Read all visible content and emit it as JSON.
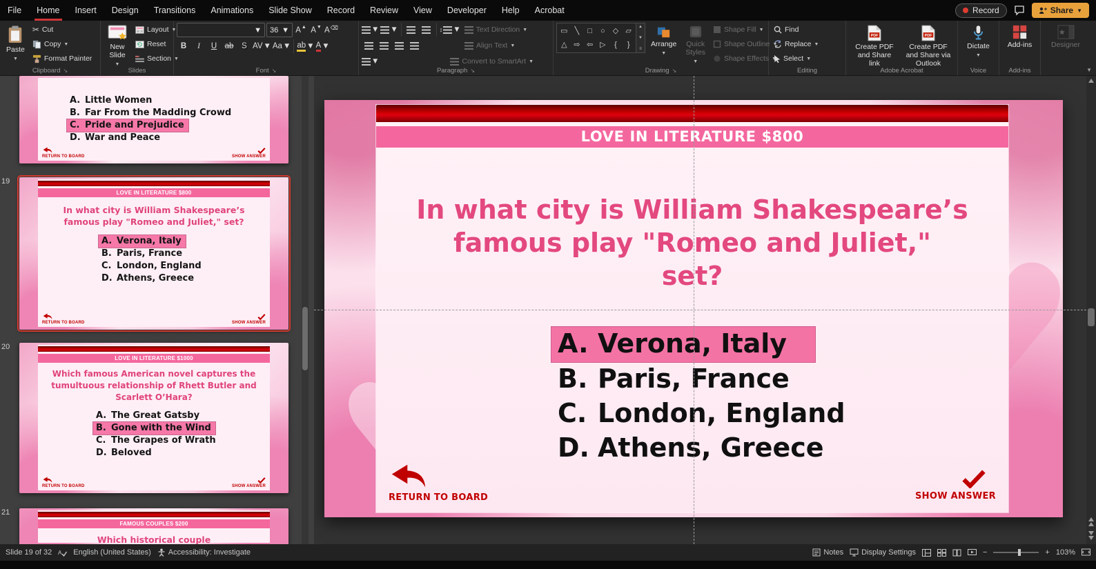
{
  "titlebar": {
    "menus": [
      "File",
      "Home",
      "Insert",
      "Design",
      "Transitions",
      "Animations",
      "Slide Show",
      "Record",
      "Review",
      "View",
      "Developer",
      "Help",
      "Acrobat"
    ],
    "record_button": "Record",
    "share_button": "Share"
  },
  "ribbon": {
    "clipboard": {
      "group": "Clipboard",
      "paste": "Paste",
      "cut": "Cut",
      "copy": "Copy",
      "format_painter": "Format Painter"
    },
    "slides": {
      "group": "Slides",
      "new_slide": "New Slide",
      "layout": "Layout",
      "reset": "Reset",
      "section": "Section"
    },
    "font": {
      "group": "Font",
      "font_name": "",
      "font_size": "36"
    },
    "paragraph": {
      "group": "Paragraph",
      "text_direction": "Text Direction",
      "align_text": "Align Text",
      "smartart": "Convert to SmartArt"
    },
    "drawing": {
      "group": "Drawing",
      "arrange": "Arrange",
      "quick_styles": "Quick Styles",
      "shape_fill": "Shape Fill",
      "shape_outline": "Shape Outline",
      "shape_effects": "Shape Effects"
    },
    "editing": {
      "group": "Editing",
      "find": "Find",
      "replace": "Replace",
      "select": "Select"
    },
    "acrobat": {
      "group": "Adobe Acrobat",
      "create_share": "Create PDF and Share link",
      "create_outlook": "Create PDF and Share via Outlook"
    },
    "voice": {
      "group": "Voice",
      "dictate": "Dictate"
    },
    "addins": {
      "group": "Add-ins",
      "addins": "Add-ins"
    },
    "designer": {
      "designer": "Designer"
    }
  },
  "thumbnails": {
    "prev_partial": {
      "options": [
        {
          "letter": "A.",
          "text": "Little Women"
        },
        {
          "letter": "B.",
          "text": "Far From the Madding Crowd"
        },
        {
          "letter": "C.",
          "text": "Pride and Prejudice"
        },
        {
          "letter": "D.",
          "text": "War and Peace"
        }
      ],
      "return_label": "RETURN TO BOARD",
      "show_label": "SHOW ANSWER"
    },
    "slide19": {
      "number": "19",
      "header": "LOVE IN LITERATURE $800",
      "question": "In what city is William Shakespeare’s famous play \"Romeo and Juliet,\" set?",
      "options": [
        {
          "letter": "A.",
          "text": "Verona, Italy"
        },
        {
          "letter": "B.",
          "text": "Paris, France"
        },
        {
          "letter": "C.",
          "text": "London, England"
        },
        {
          "letter": "D.",
          "text": "Athens, Greece"
        }
      ],
      "return_label": "RETURN TO BOARD",
      "show_label": "SHOW ANSWER"
    },
    "slide20": {
      "number": "20",
      "header": "LOVE IN LITERATURE $1000",
      "question": "Which famous American novel captures the tumultuous relationship of Rhett Butler and Scarlett O’Hara?",
      "options": [
        {
          "letter": "A.",
          "text": "The Great Gatsby"
        },
        {
          "letter": "B.",
          "text": "Gone with the Wind"
        },
        {
          "letter": "C.",
          "text": "The Grapes of Wrath"
        },
        {
          "letter": "D.",
          "text": "Beloved"
        }
      ],
      "return_label": "RETURN TO BOARD",
      "show_label": "SHOW ANSWER"
    },
    "slide21": {
      "number": "21",
      "header": "FAMOUS COUPLES $200",
      "question_partial": "Which historical couple"
    }
  },
  "slide": {
    "header": "LOVE IN LITERATURE $800",
    "question_line1": "In what city is William Shakespeare’s",
    "question_line2": "famous play \"Romeo and Juliet,\"",
    "question_line3": "set?",
    "options": [
      {
        "letter": "A.",
        "text": "Verona, Italy"
      },
      {
        "letter": "B.",
        "text": "Paris, France"
      },
      {
        "letter": "C.",
        "text": "London, England"
      },
      {
        "letter": "D.",
        "text": "Athens, Greece"
      }
    ],
    "return_label": "RETURN TO BOARD",
    "show_label": "SHOW ANSWER"
  },
  "statusbar": {
    "slide_info": "Slide 19 of 32",
    "language": "English (United States)",
    "accessibility": "Accessibility: Investigate",
    "notes": "Notes",
    "display_settings": "Display Settings",
    "zoom_level": "103%"
  },
  "colors": {
    "accent_red": "#c00000",
    "header_band_pink": "#f4679e",
    "question_pink": "#e3487f",
    "highlight_pink": "#f473a5",
    "selection_red": "#d0392e",
    "share_orange": "#e9a23b"
  }
}
